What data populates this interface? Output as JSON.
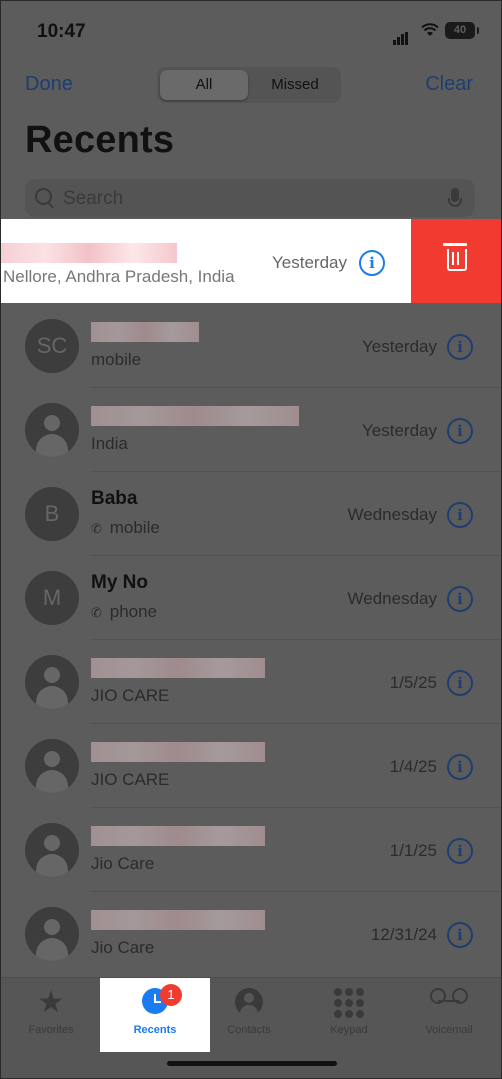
{
  "status": {
    "time": "10:47",
    "battery": "40"
  },
  "nav": {
    "done": "Done",
    "clear": "Clear",
    "segments": [
      "All",
      "Missed"
    ],
    "selected": "All"
  },
  "title": "Recents",
  "search": {
    "placeholder": "Search"
  },
  "swiped_row": {
    "subtitle": "Nellore, Andhra Pradesh, India",
    "date": "Yesterday",
    "action": "delete"
  },
  "rows": [
    {
      "initials": "SC",
      "name": "",
      "sub": "mobile",
      "date": "Yesterday",
      "phone_icon": false
    },
    {
      "initials": "",
      "name": "",
      "sub": "India",
      "date": "Yesterday",
      "phone_icon": false
    },
    {
      "initials": "B",
      "name": "Baba",
      "sub": "mobile",
      "date": "Wednesday",
      "phone_icon": true
    },
    {
      "initials": "M",
      "name": "My No",
      "sub": "phone",
      "date": "Wednesday",
      "phone_icon": true
    },
    {
      "initials": "",
      "name": "",
      "sub": "JIO CARE",
      "date": "1/5/25",
      "phone_icon": false
    },
    {
      "initials": "",
      "name": "",
      "sub": "JIO CARE",
      "date": "1/4/25",
      "phone_icon": false
    },
    {
      "initials": "",
      "name": "",
      "sub": "Jio Care",
      "date": "1/1/25",
      "phone_icon": false
    },
    {
      "initials": "",
      "name": "",
      "sub": "Jio Care",
      "date": "12/31/24",
      "phone_icon": false
    }
  ],
  "tabs": [
    {
      "label": "Favorites",
      "icon": "star-icon"
    },
    {
      "label": "Recents",
      "icon": "clock-icon",
      "badge": "1",
      "active": true
    },
    {
      "label": "Contacts",
      "icon": "contact-icon"
    },
    {
      "label": "Keypad",
      "icon": "keypad-icon"
    },
    {
      "label": "Voicemail",
      "icon": "voicemail-icon"
    }
  ],
  "colors": {
    "accent": "#1a7cf1",
    "delete": "#f23b30",
    "dim_overlay": "#5c5c5c"
  }
}
